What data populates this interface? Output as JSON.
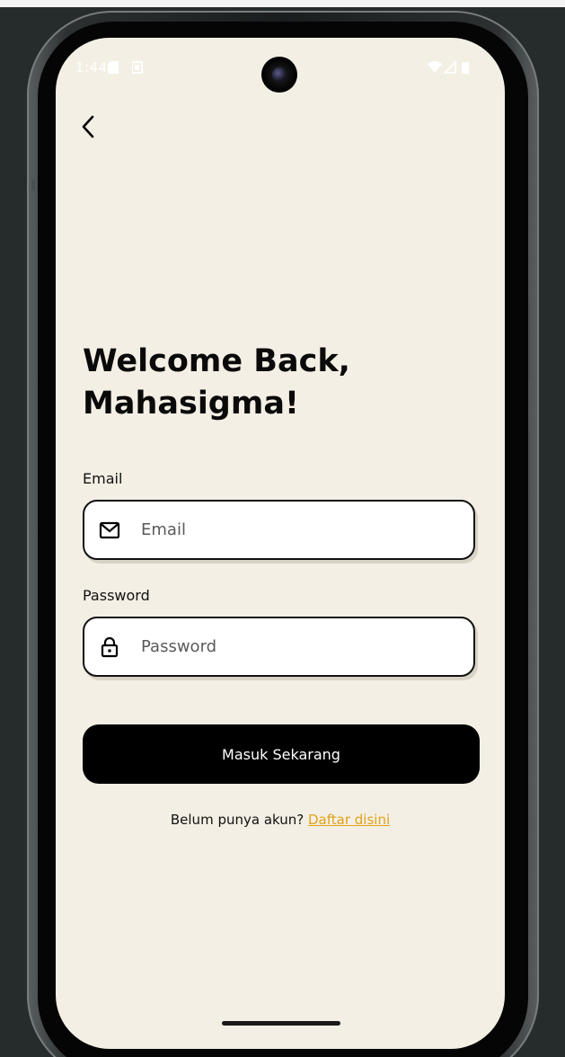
{
  "status_bar": {
    "time": "1:44"
  },
  "login": {
    "title_line1": "Welcome Back,",
    "title_line2": "Mahasigma!",
    "email_label": "Email",
    "email_placeholder": "Email",
    "password_label": "Password",
    "password_placeholder": "Password",
    "submit_label": "Masuk Sekarang",
    "signup_prompt": "Belum punya akun?",
    "signup_link": "Daftar disini"
  },
  "icons": {
    "back": "chevron-left-icon",
    "email": "mail-icon",
    "password": "lock-icon"
  },
  "colors": {
    "background": "#f4efe4",
    "button": "#000000",
    "link": "#e0a21a"
  }
}
